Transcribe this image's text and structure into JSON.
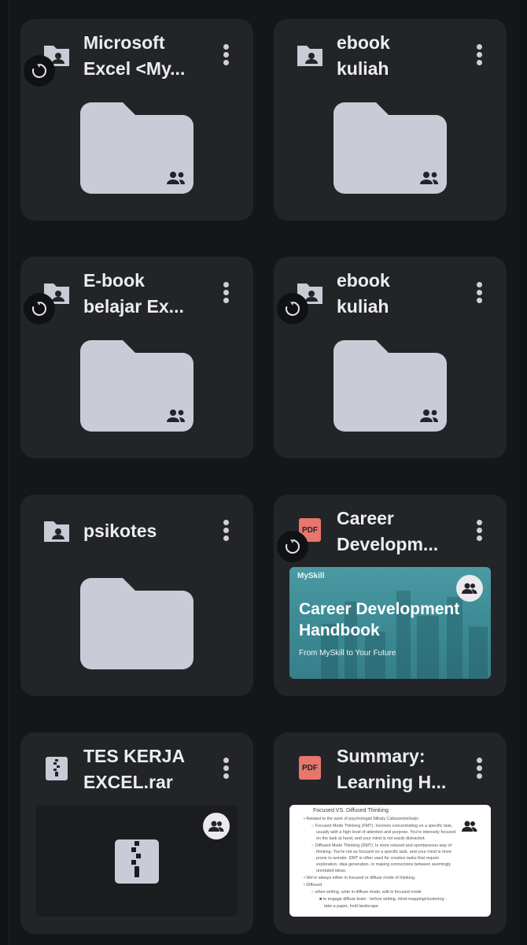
{
  "files": [
    {
      "title": "Microsoft\nExcel <My...",
      "type": "shared-folder",
      "synced": true
    },
    {
      "title": "ebook\nkuliah",
      "type": "shared-folder",
      "synced": false
    },
    {
      "title": "E-book\nbelajar Ex...",
      "type": "shared-folder",
      "synced": true
    },
    {
      "title": "ebook\nkuliah",
      "type": "shared-folder",
      "synced": true
    },
    {
      "title": "psikotes",
      "type": "shared-folder",
      "synced": false
    },
    {
      "title": "Career\nDevelopm...",
      "type": "pdf",
      "synced": true,
      "preview": {
        "brand": "MySkill",
        "heading": "Career Development Handbook",
        "subtitle": "From MySkill to Your Future"
      }
    },
    {
      "title": "TES KERJA\nEXCEL.rar",
      "type": "archive",
      "synced": false
    },
    {
      "title": "Summary:\nLearning H...",
      "type": "pdf",
      "synced": false,
      "preview": {
        "heading": "Focused VS. Diffused Thinking",
        "lines": [
          "• Related to the work of psychologist Mihaly Csikszentmihalyi",
          "○ Focused Mode Thinking (FMT): Involves concentrating on a specific task,",
          "usually with a high level of attention and purpose. You're intensely focused",
          "on the task at hand, and your mind is not easily distracted.",
          "○ Diffused Mode Thinking (DMT): Is more relaxed and spontaneous way of",
          "thinking. You're not as focused on a specific task, and your mind is more",
          "prone to wonder. DMT is often used for creative tasks that require",
          "exploration, idea generation, or making connections between seemingly",
          "unrelated ideas.",
          "• We're always either in focused or diffuse mode of thinking.",
          "• Diffused",
          "○ when writing, write in diffuse mode, edit in focused mode",
          "■ to engage diffuse brain - before writing, mind-mapping/clustering -",
          "take a paper, hold landscape"
        ]
      }
    }
  ],
  "colors": {
    "background": "#151619",
    "card": "#232428",
    "folder": "#cacbd6",
    "pdf": "#e7766c",
    "career": "#3e8c96"
  },
  "icons": {
    "folder_type": "shared-folder-icon",
    "pdf_type": "pdf-icon",
    "archive_type": "zip-icon",
    "menu": "more-vert-icon",
    "sync": "sync-icon",
    "shared": "people-icon"
  }
}
